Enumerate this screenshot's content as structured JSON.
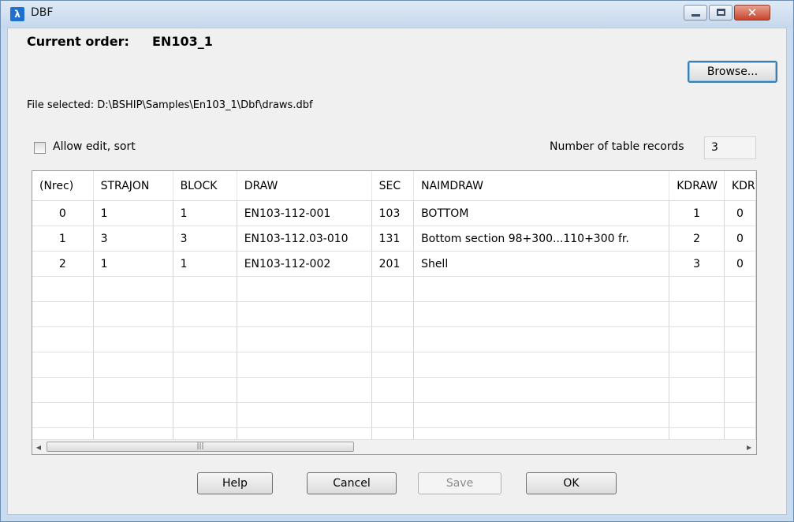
{
  "window": {
    "title": "DBF",
    "app_icon_glyph": "λ"
  },
  "header": {
    "order_label": "Current order:",
    "order_value": "EN103_1",
    "browse_label": "Browse...",
    "file_line": "File selected: D:\\BSHIP\\Samples\\En103_1\\Dbf\\draws.dbf"
  },
  "options": {
    "allow_edit_label": "Allow edit, sort",
    "allow_edit_checked": false,
    "records_label": "Number of table records",
    "records_value": "3"
  },
  "table": {
    "columns": [
      "(Nrec)",
      "STRAJON",
      "BLOCK",
      "DRAW",
      "SEC",
      "NAIMDRAW",
      "KDRAW",
      "KDR"
    ],
    "rows": [
      [
        "0",
        "1",
        "1",
        "EN103-112-001",
        "103",
        "BOTTOM",
        "1",
        "0"
      ],
      [
        "1",
        "3",
        "3",
        "EN103-112.03-010",
        "131",
        "Bottom section 98+300...110+300 fr.",
        "2",
        "0"
      ],
      [
        "2",
        "1",
        "1",
        "EN103-112-002",
        "201",
        "Shell",
        "3",
        "0"
      ]
    ]
  },
  "scrollbar": {
    "left_arrow": "◂",
    "right_arrow": "▸",
    "thumb_grip": "|||"
  },
  "buttons": {
    "help": "Help",
    "cancel": "Cancel",
    "save": "Save",
    "ok": "OK"
  }
}
